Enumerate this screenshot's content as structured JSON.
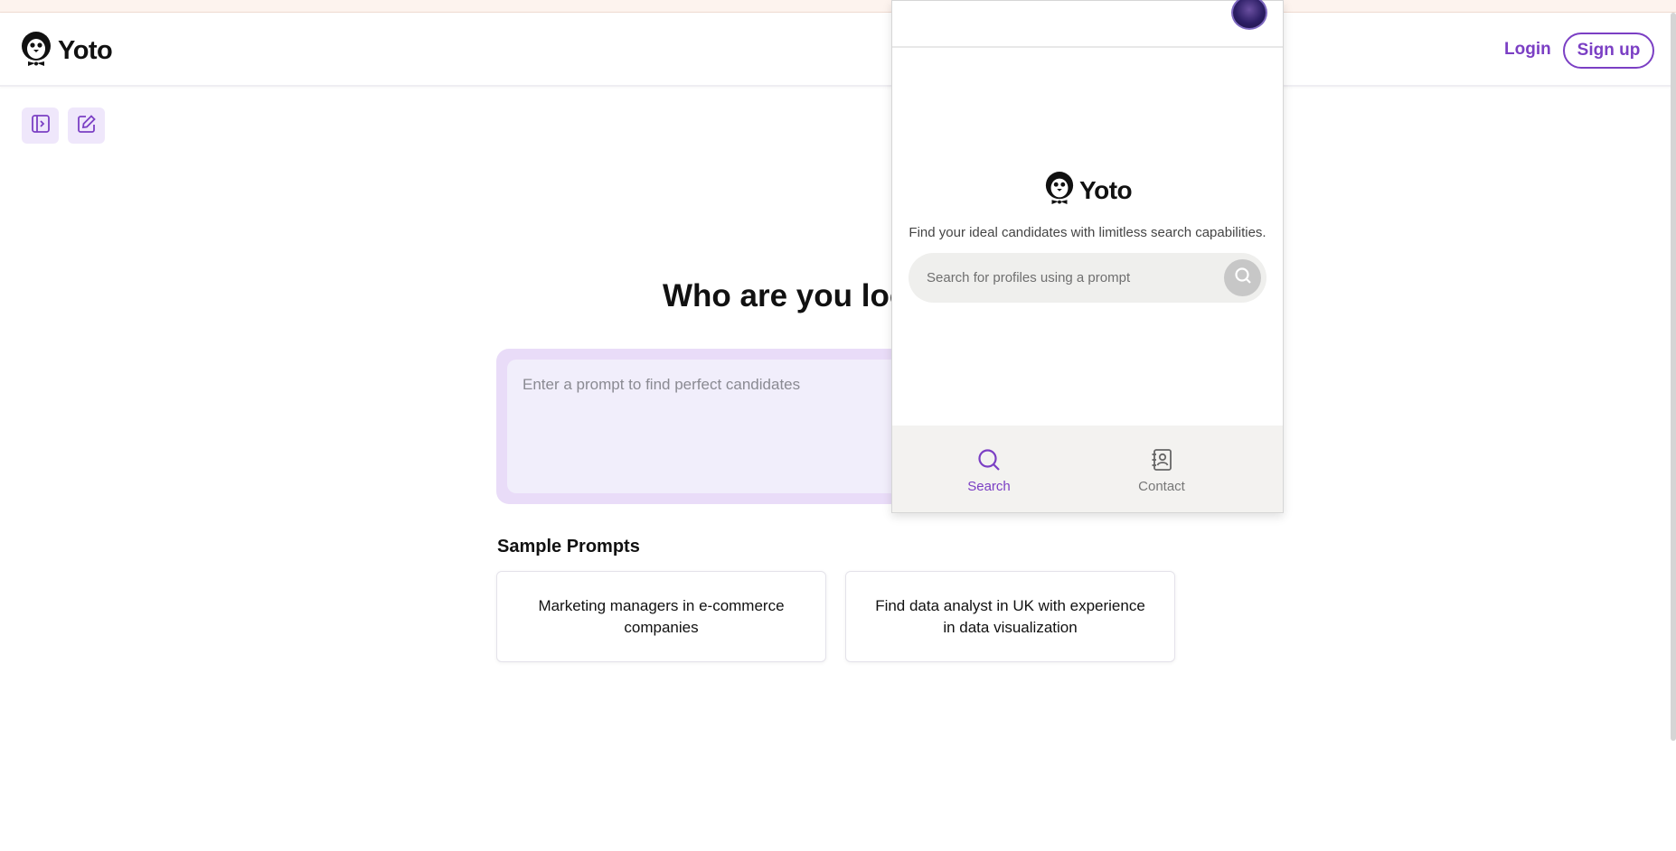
{
  "app": {
    "brand": "Yoto"
  },
  "header": {
    "login_label": "Login",
    "signup_label": "Sign up"
  },
  "toolbar": {
    "icons": [
      "sidebar-toggle-icon",
      "edit-icon"
    ]
  },
  "main": {
    "heading": "Who are you look",
    "prompt_placeholder": "Enter a prompt to find perfect candidates",
    "sample_title": "Sample Prompts",
    "samples": [
      "Marketing managers in e-commerce companies",
      "Find data analyst in UK with experience in data visualization"
    ]
  },
  "popup": {
    "brand": "Yoto",
    "tagline": "Find your ideal candidates with limitless search capabilities.",
    "search_placeholder": "Search for profiles using a prompt",
    "nav": [
      {
        "label": "Search",
        "icon": "search-icon",
        "active": true
      },
      {
        "label": "Contact",
        "icon": "contact-book-icon",
        "active": false
      }
    ]
  },
  "colors": {
    "accent": "#7b3fc4",
    "accent_light": "#efe7fb",
    "prompt_bg": "#e9dcf8"
  }
}
